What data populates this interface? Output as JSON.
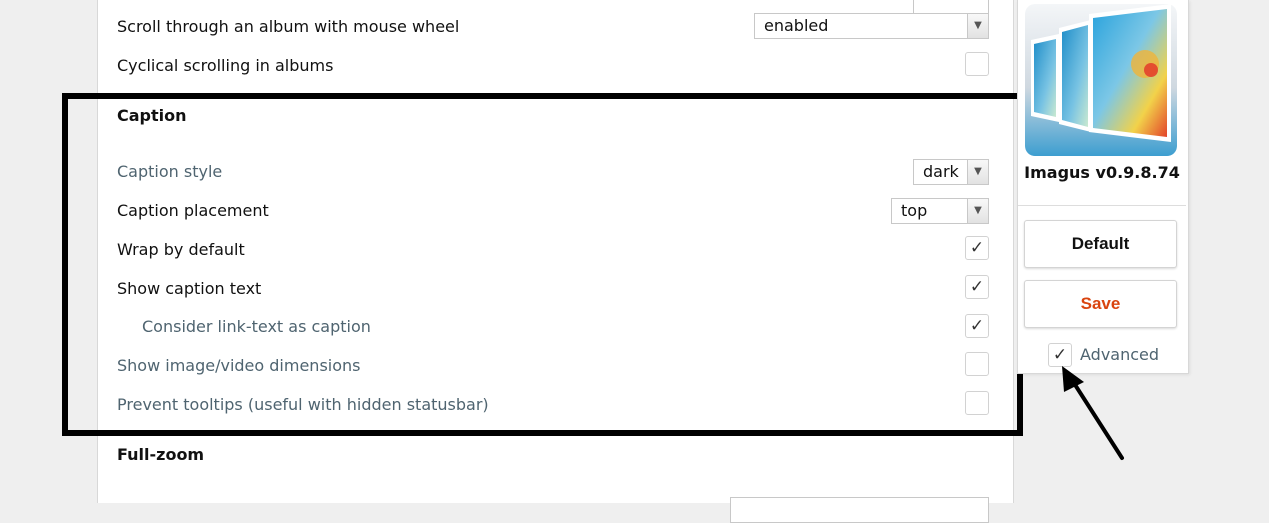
{
  "settings": {
    "scroll_album": {
      "label": "Scroll through an album with mouse wheel",
      "value": "enabled"
    },
    "cyclical": {
      "label": "Cyclical scrolling in albums",
      "checked": false
    }
  },
  "caption": {
    "title": "Caption",
    "style": {
      "label": "Caption style",
      "value": "dark"
    },
    "placement": {
      "label": "Caption placement",
      "value": "top"
    },
    "wrap": {
      "label": "Wrap by default",
      "checked": true,
      "mark": "✓"
    },
    "show_text": {
      "label": "Show caption text",
      "checked": true,
      "mark": "✓"
    },
    "link_text": {
      "label": "Consider link-text as caption",
      "checked": true,
      "mark": "✓"
    },
    "dimensions": {
      "label": "Show image/video dimensions",
      "checked": false
    },
    "tooltips": {
      "label": "Prevent tooltips (useful with hidden statusbar)",
      "checked": false
    }
  },
  "fullzoom": {
    "title": "Full-zoom"
  },
  "sidebar": {
    "app_name": "Imagus v0.9.8.74",
    "default_label": "Default",
    "save_label": "Save",
    "advanced": {
      "label": "Advanced",
      "checked": true,
      "mark": "✓"
    }
  },
  "colors": {
    "muted_text": "#4f6470",
    "save_text": "#d9440f",
    "highlight_frame": "#000000"
  }
}
